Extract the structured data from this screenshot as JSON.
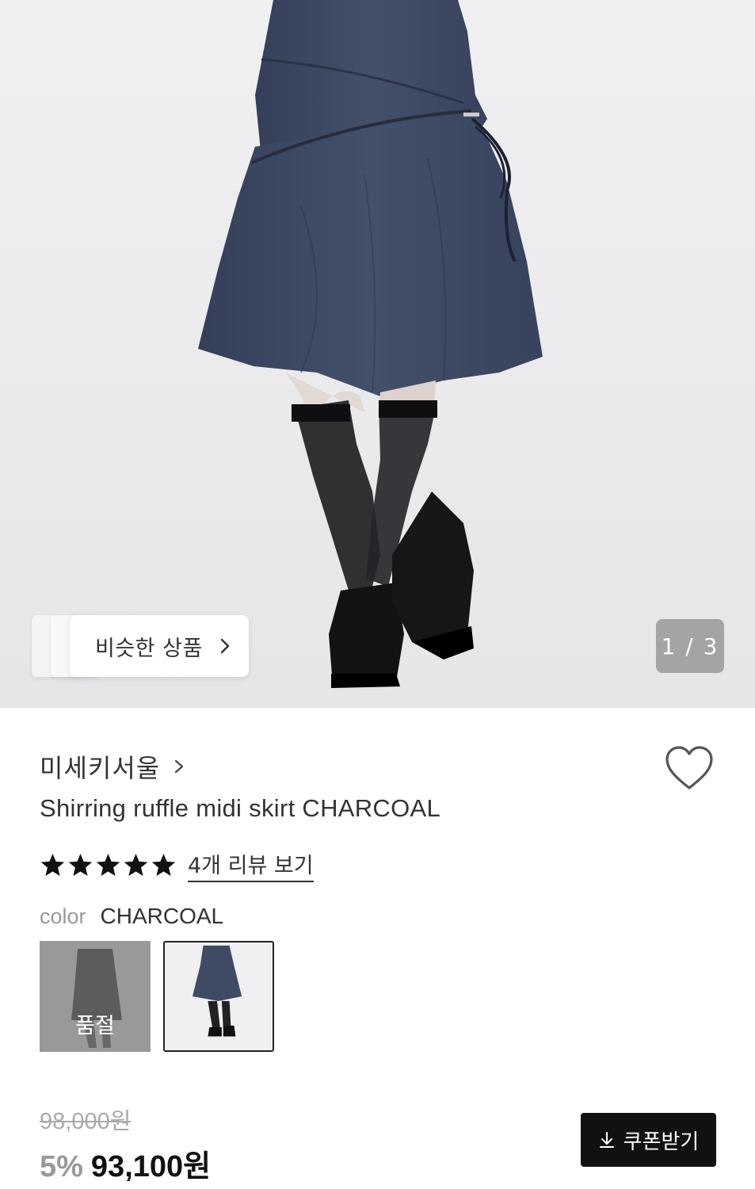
{
  "hero": {
    "similar_label": "비슷한 상품",
    "counter": "1 / 3",
    "icons": {
      "similar_chevron": "chevron-right-icon"
    }
  },
  "product": {
    "brand": "미세키서울",
    "title": "Shirring ruffle midi skirt CHARCOAL",
    "rating_stars": 5,
    "review_link": "4개 리뷰 보기",
    "color_label": "color",
    "color_value": "CHARCOAL",
    "swatches": [
      {
        "state": "sold-out",
        "overlay": "품절"
      },
      {
        "state": "selected"
      }
    ],
    "original_price": "98,000원",
    "discount": "5%",
    "sale_price": "93,100원",
    "coupon_label": "쿠폰받기"
  },
  "colors": {
    "skirt": "#3f4b63",
    "button_bg": "#111111",
    "counter_bg": "#a4a4a6"
  }
}
